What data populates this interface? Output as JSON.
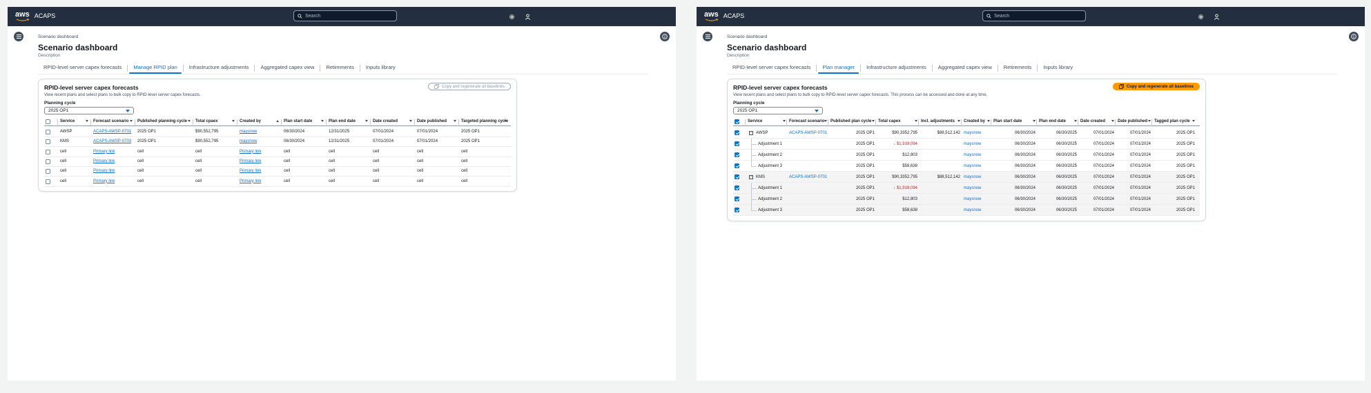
{
  "left": {
    "app_title": "ACAPS",
    "search_placeholder": "Search",
    "breadcrumb": "Scenario dashboard",
    "page_title": "Scenario dashboard",
    "page_desc": "Description",
    "tabs": [
      "RPID-level server capex forecasts",
      "Manage RPID plan",
      "Infrastructure adjustments",
      "Aggregated capex view",
      "Retirements",
      "Inputs library"
    ],
    "active_tab": 1,
    "panel_title": "RPID-level server capex forecasts",
    "panel_desc": "View recent plans and select plans to bulk copy to RPID-level server capex forecasts.",
    "copy_button": "Copy and regenerate all baselines",
    "cycle_label": "Planning cycle",
    "cycle_value": "2025 OP1",
    "columns": [
      "Service",
      "Forecast scenario",
      "Published planning cycle",
      "Total cpaex",
      "Created by",
      "Plan start date",
      "Plan end date",
      "Date created",
      "Date published",
      "Targeted planning cycle"
    ],
    "rows": [
      [
        "AWSP",
        "ACAPS-AWSP-0701",
        "2025 OP1",
        "$90,552,795",
        "maysnow",
        "06/30/2024",
        "12/31/2025",
        "07/01/2024",
        "07/01/2024",
        "2025 OP1"
      ],
      [
        "KMS",
        "ACAPS-AWSP-0703",
        "2025 OP1",
        "$90,552,795",
        "maysnow",
        "06/30/2024",
        "12/31/2025",
        "07/01/2024",
        "07/01/2024",
        "2025 OP1"
      ],
      [
        "cell",
        "Primary link",
        "cell",
        "cell",
        "Primary link",
        "cell",
        "cell",
        "cell",
        "cell",
        "cell"
      ],
      [
        "cell",
        "Primary link",
        "cell",
        "cell",
        "Primary link",
        "cell",
        "cell",
        "cell",
        "cell",
        "cell"
      ],
      [
        "cell",
        "Primary link",
        "cell",
        "cell",
        "Primary link",
        "cell",
        "cell",
        "cell",
        "cell",
        "cell"
      ],
      [
        "cell",
        "Primary link",
        "cell",
        "cell",
        "Primary link",
        "cell",
        "cell",
        "cell",
        "cell",
        "cell"
      ]
    ]
  },
  "right": {
    "app_title": "ACAPS",
    "search_placeholder": "Search",
    "breadcrumb": "Scenario dashboard",
    "page_title": "Scenario dashboard",
    "page_desc": "Description",
    "tabs": [
      "RPID-level server capex forecasts",
      "Plan manager",
      "Infrastructure adjustments",
      "Aggregated capex view",
      "Retirements",
      "Inputs library"
    ],
    "active_tab": 1,
    "panel_title": "RPID-level server capex forecasts",
    "panel_desc": "View recent plans and select plans to bulk copy to RPID-level server capex forecasts. This process can be accessed and done at any time.",
    "copy_button": "Copy and regenerate all baselines",
    "cycle_label": "Planning cycle",
    "cycle_value": "2025 OP1",
    "columns": [
      "Service",
      "Forecast scenario",
      "Published plan cycle",
      "Total capex",
      "Incl. adjustments",
      "Created by",
      "Plan start date",
      "Plan end date",
      "Date created",
      "Date published",
      "Tagged plan cycle"
    ],
    "rows": [
      {
        "level": 0,
        "service": "AWSP",
        "scenario": "ACAPS-AWSP-0701",
        "cycle": "2025 OP1",
        "capex": "$90,3352,795",
        "negative": false,
        "incl": "$88,512,142",
        "by": "maysnow",
        "start": "06/30/2024",
        "end": "06/30/2025",
        "created": "07/01/2024",
        "published": "07/01/2024",
        "tagged": "2025 OP1"
      },
      {
        "level": 1,
        "service": "Adjustment 1",
        "scenario": "",
        "cycle": "2025 OP1",
        "capex": "$1,919,094",
        "negative": true,
        "incl": "",
        "by": "maysnow",
        "start": "06/30/2024",
        "end": "06/30/2025",
        "created": "07/01/2024",
        "published": "07/01/2024",
        "tagged": "2025 OP1"
      },
      {
        "level": 1,
        "service": "Adjustment 2",
        "scenario": "",
        "cycle": "2025 OP1",
        "capex": "$12,803",
        "negative": false,
        "incl": "",
        "by": "maysnow",
        "start": "06/30/2024",
        "end": "06/30/2025",
        "created": "07/01/2024",
        "published": "07/01/2024",
        "tagged": "2025 OP1"
      },
      {
        "level": 1,
        "service": "Adjustment 3",
        "scenario": "",
        "cycle": "2025 OP1",
        "capex": "$58,638",
        "negative": false,
        "incl": "",
        "by": "maysnow",
        "start": "06/30/2024",
        "end": "06/30/2025",
        "created": "07/01/2024",
        "published": "07/01/2024",
        "tagged": "2025 OP1"
      },
      {
        "level": 0,
        "service": "KMS",
        "scenario": "ACAPS-AWSP-0701",
        "cycle": "2025 OP1",
        "capex": "$90,3352,795",
        "negative": false,
        "incl": "$88,512,142",
        "by": "maysnow",
        "start": "06/30/2024",
        "end": "06/30/2025",
        "created": "07/01/2024",
        "published": "07/01/2024",
        "tagged": "2025 OP1"
      },
      {
        "level": 1,
        "service": "Adjustment 1",
        "scenario": "",
        "cycle": "2025 OP1",
        "capex": "$1,919,094",
        "negative": true,
        "incl": "",
        "by": "maysnow",
        "start": "06/30/2024",
        "end": "06/30/2025",
        "created": "07/01/2024",
        "published": "07/01/2024",
        "tagged": "2025 OP1"
      },
      {
        "level": 1,
        "service": "Adjustment 2",
        "scenario": "",
        "cycle": "2025 OP1",
        "capex": "$12,803",
        "negative": false,
        "incl": "",
        "by": "maysnow",
        "start": "06/30/2024",
        "end": "06/30/2025",
        "created": "07/01/2024",
        "published": "07/01/2024",
        "tagged": "2025 OP1"
      },
      {
        "level": 1,
        "service": "Adjustment 3",
        "scenario": "",
        "cycle": "2025 OP1",
        "capex": "$58,638",
        "negative": false,
        "incl": "",
        "by": "maysnow",
        "start": "06/30/2024",
        "end": "06/30/2025",
        "created": "07/01/2024",
        "published": "07/01/2024",
        "tagged": "2025 OP1"
      }
    ]
  },
  "colors": {
    "topbar": "#232f3e",
    "link": "#0972d3",
    "primary_button": "#ff9900",
    "negative": "#d91515"
  }
}
